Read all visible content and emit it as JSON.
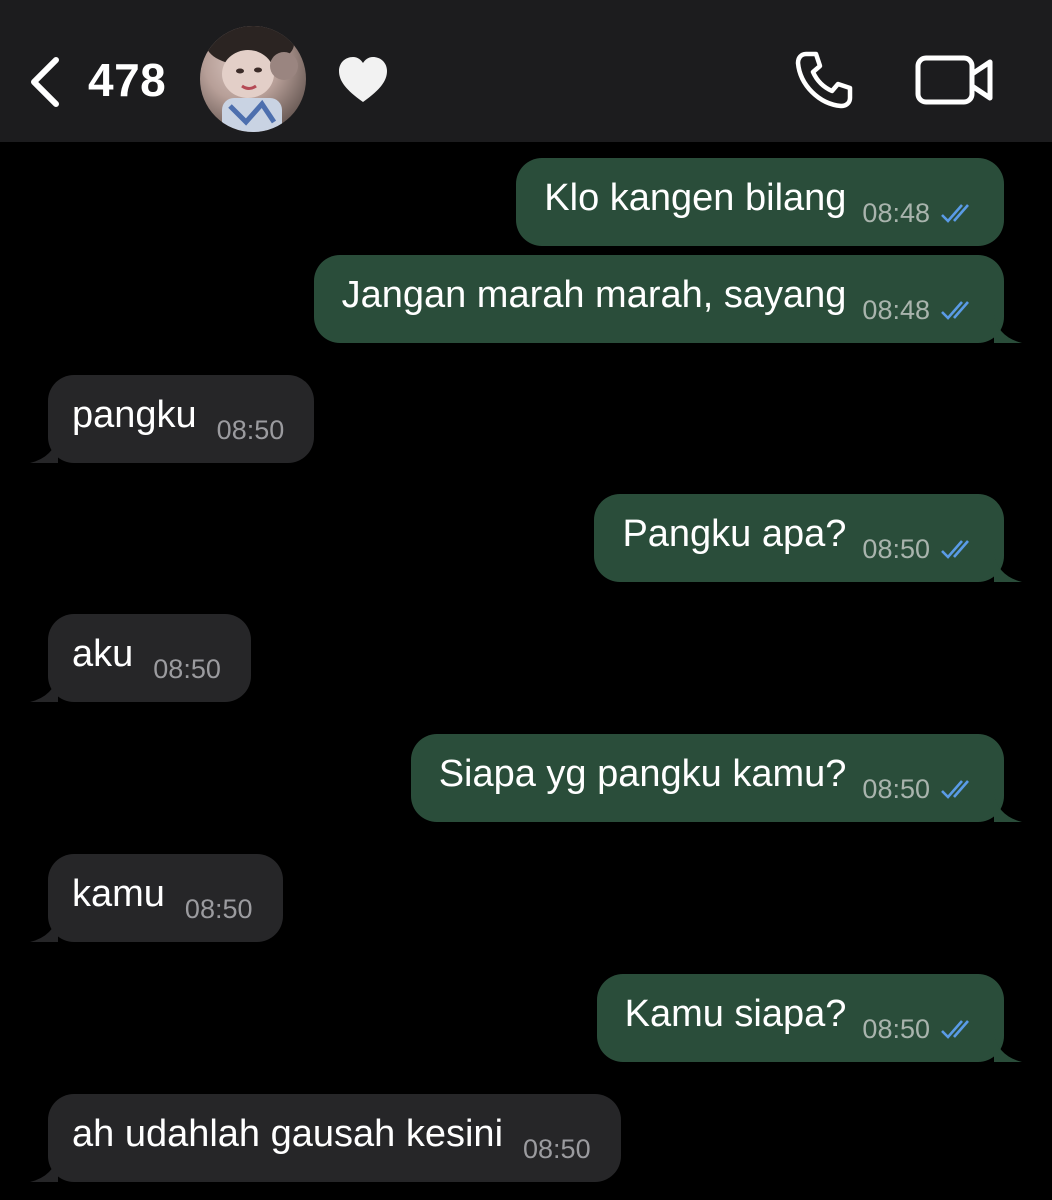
{
  "header": {
    "unread_count": "478",
    "contact_emoji": "heart",
    "back_icon": "chevron-left-icon",
    "call_icon": "phone-icon",
    "video_icon": "video-camera-icon"
  },
  "colors": {
    "header_bg": "#1c1c1e",
    "outgoing_bubble": "#2a4d3a",
    "incoming_bubble": "#262628",
    "read_ticks": "#5a9be6"
  },
  "messages": [
    {
      "direction": "outgoing",
      "text": "Klo kangen bilang",
      "time": "08:48",
      "status": "read"
    },
    {
      "direction": "outgoing",
      "text": "Jangan marah marah, sayang",
      "time": "08:48",
      "status": "read"
    },
    {
      "direction": "incoming",
      "text": "pangku",
      "time": "08:50"
    },
    {
      "direction": "outgoing",
      "text": "Pangku apa?",
      "time": "08:50",
      "status": "read"
    },
    {
      "direction": "incoming",
      "text": "aku",
      "time": "08:50"
    },
    {
      "direction": "outgoing",
      "text": "Siapa yg pangku kamu?",
      "time": "08:50",
      "status": "read"
    },
    {
      "direction": "incoming",
      "text": "kamu",
      "time": "08:50"
    },
    {
      "direction": "outgoing",
      "text": "Kamu siapa?",
      "time": "08:50",
      "status": "read"
    },
    {
      "direction": "incoming",
      "text": "ah udahlah gausah kesini",
      "time": "08:50"
    }
  ]
}
